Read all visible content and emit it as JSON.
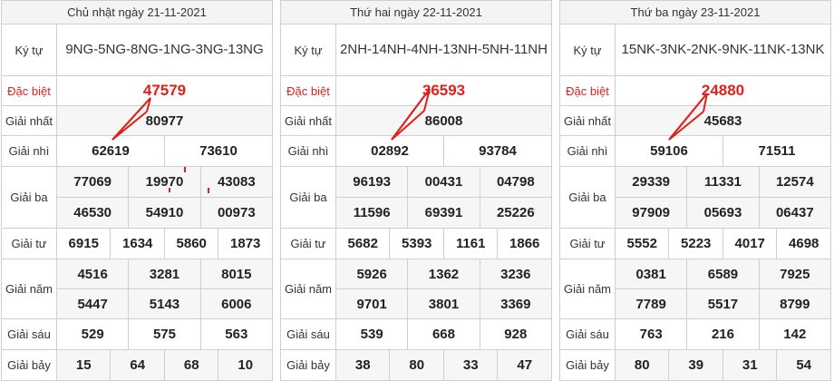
{
  "panels": [
    {
      "date": "Chủ nhật ngày 21-11-2021",
      "label_code": "Ký tự",
      "code": "9NG-5NG-8NG-1NG-3NG-13NG",
      "rows": {
        "special": {
          "label": "Đặc biệt",
          "values": [
            "47579"
          ]
        },
        "first": {
          "label": "Giải nhất",
          "values": [
            "80977"
          ]
        },
        "second": {
          "label": "Giải nhì",
          "values": [
            "62619",
            "73610"
          ]
        },
        "third": {
          "label": "Giải ba",
          "values": [
            "77069",
            "19970",
            "43083",
            "46530",
            "54910",
            "00973"
          ]
        },
        "fourth": {
          "label": "Giải tư",
          "values": [
            "6915",
            "1634",
            "5860",
            "1873"
          ]
        },
        "fifth": {
          "label": "Giải năm",
          "values": [
            "4516",
            "3281",
            "8015",
            "5447",
            "5143",
            "6006"
          ]
        },
        "sixth": {
          "label": "Giải sáu",
          "values": [
            "529",
            "575",
            "563"
          ]
        },
        "seventh": {
          "label": "Giải bảy",
          "values": [
            "15",
            "64",
            "68",
            "10"
          ]
        }
      }
    },
    {
      "date": "Thứ hai ngày 22-11-2021",
      "label_code": "Ký tự",
      "code": "2NH-14NH-4NH-13NH-5NH-11NH",
      "rows": {
        "special": {
          "label": "Đặc biệt",
          "values": [
            "36593"
          ]
        },
        "first": {
          "label": "Giải nhất",
          "values": [
            "86008"
          ]
        },
        "second": {
          "label": "Giải nhì",
          "values": [
            "02892",
            "93784"
          ]
        },
        "third": {
          "label": "Giải ba",
          "values": [
            "96193",
            "00431",
            "04798",
            "11596",
            "69391",
            "25226"
          ]
        },
        "fourth": {
          "label": "Giải tư",
          "values": [
            "5682",
            "5393",
            "1161",
            "1866"
          ]
        },
        "fifth": {
          "label": "Giải năm",
          "values": [
            "5926",
            "1362",
            "3236",
            "9701",
            "3801",
            "3369"
          ]
        },
        "sixth": {
          "label": "Giải sáu",
          "values": [
            "539",
            "668",
            "928"
          ]
        },
        "seventh": {
          "label": "Giải bảy",
          "values": [
            "38",
            "80",
            "33",
            "47"
          ]
        }
      }
    },
    {
      "date": "Thứ ba ngày 23-11-2021",
      "label_code": "Ký tự",
      "code": "15NK-3NK-2NK-9NK-11NK-13NK",
      "rows": {
        "special": {
          "label": "Đặc biệt",
          "values": [
            "24880"
          ]
        },
        "first": {
          "label": "Giải nhất",
          "values": [
            "45683"
          ]
        },
        "second": {
          "label": "Giải nhì",
          "values": [
            "59106",
            "71511"
          ]
        },
        "third": {
          "label": "Giải ba",
          "values": [
            "29339",
            "11331",
            "12574",
            "97909",
            "05693",
            "06437"
          ]
        },
        "fourth": {
          "label": "Giải tư",
          "values": [
            "5552",
            "5223",
            "4017",
            "4698"
          ]
        },
        "fifth": {
          "label": "Giải năm",
          "values": [
            "0381",
            "6589",
            "7925",
            "7789",
            "5517",
            "8799"
          ]
        },
        "sixth": {
          "label": "Giải sáu",
          "values": [
            "763",
            "216",
            "142"
          ]
        },
        "seventh": {
          "label": "Giải bảy",
          "values": [
            "80",
            "39",
            "31",
            "54"
          ]
        }
      }
    }
  ],
  "colors": {
    "special": "#e0201b",
    "annotation": "#e0201b",
    "border": "#cfcfcf"
  }
}
